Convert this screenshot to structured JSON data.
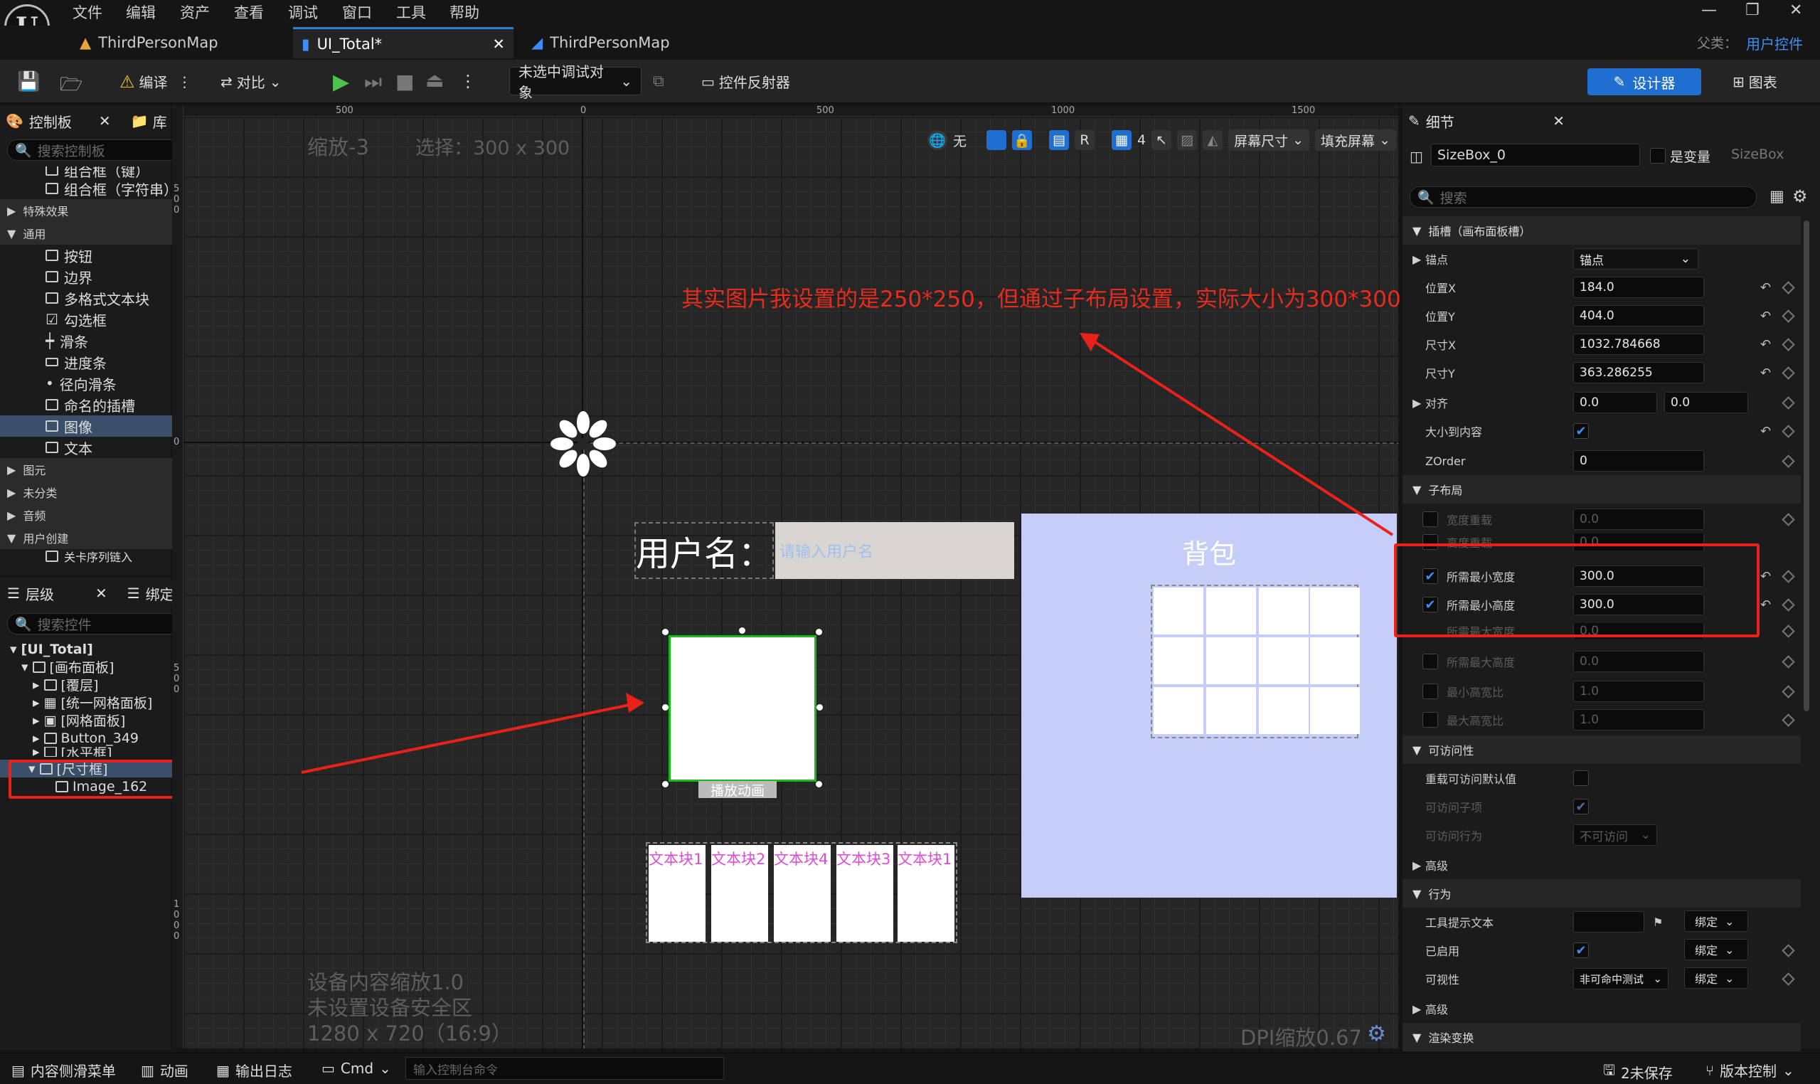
{
  "menu": [
    "文件",
    "编辑",
    "资产",
    "查看",
    "调试",
    "窗口",
    "工具",
    "帮助"
  ],
  "tabs": [
    "ThirdPersonMap",
    "UI_Total*",
    "ThirdPersonMap"
  ],
  "parent_label": "父类：",
  "parent_value": "用户控件",
  "toolbar": {
    "compile": "编译",
    "diff": "对比",
    "debug_target": "未选中调试对象",
    "widget_reflector": "控件反射器",
    "designer": "设计器",
    "graph": "图表"
  },
  "palette": {
    "tab1": "控制板",
    "tab2": "库",
    "search_placeholder": "搜索控制板",
    "partial_items": [
      "组合框（键）",
      "组合框（字符串）"
    ],
    "cat_effects": "特殊效果",
    "cat_common": "通用",
    "common_items": [
      "按钮",
      "边界",
      "多格式文本块",
      "勾选框",
      "滑条",
      "进度条",
      "径向滑条",
      "命名的插槽",
      "图像",
      "文本"
    ],
    "cat_primitive": "图元",
    "cat_uncategorized": "未分类",
    "cat_audio": "音频",
    "cat_user": "用户创建",
    "partial_user_item": "关卡序列链入"
  },
  "hierarchy": {
    "tab1": "层级",
    "tab2": "绑定控件",
    "search_placeholder": "搜索控件",
    "rows": [
      "[UI_Total]",
      "[画布面板]",
      "[覆层]",
      "[统一网格面板]",
      "[网格面板]",
      "Button_349",
      "[水平框]",
      "[尺寸框]",
      "Image_162"
    ]
  },
  "canvas": {
    "zoom": "缩放-3",
    "selection": "选择：300 x 300",
    "none_label": "无",
    "grid_num": "4",
    "r_label": "R",
    "screen_size": "屏幕尺寸",
    "fill_screen": "填充屏幕",
    "device_scale": "设备内容缩放1.0",
    "safe_zone": "未设置设备安全区",
    "resolution": "1280 x 720（16:9）",
    "dpi": "DPI缩放0.67",
    "ruler_top": [
      "500",
      "0",
      "500",
      "1000",
      "1500"
    ],
    "ruler_left": [
      "5 0 0",
      "0",
      "5 0 0",
      "1 0 0 0"
    ],
    "username_label": "用户名：",
    "username_placeholder": "请输入用户名",
    "bag_title": "背包",
    "play_anim": "播放动画",
    "text_blocks": [
      "文本块1",
      "文本块2",
      "文本块4",
      "文本块3",
      "文本块1"
    ]
  },
  "annotation": "其实图片我设置的是250*250，但通过子布局设置，实际大小为300*300",
  "details": {
    "tab": "细节",
    "widget_name": "SizeBox_0",
    "is_variable": "是变量",
    "widget_type": "SizeBox",
    "search_placeholder": "搜索",
    "slot_section": "插槽（画布面板槽）",
    "anchor_label": "锚点",
    "anchor_value": "锚点",
    "pos_x_label": "位置X",
    "pos_x": "184.0",
    "pos_y_label": "位置Y",
    "pos_y": "404.0",
    "size_x_label": "尺寸X",
    "size_x": "1032.784668",
    "size_y_label": "尺寸Y",
    "size_y": "363.286255",
    "align_label": "对齐",
    "align_x": "0.0",
    "align_y": "0.0",
    "size_to_content": "大小到内容",
    "zorder_label": "ZOrder",
    "zorder": "0",
    "child_layout": "子布局",
    "width_override": "宽度重载",
    "width_override_val": "0.0",
    "height_override": "高度重载",
    "height_override_val": "0.0",
    "min_width": "所需最小宽度",
    "min_width_val": "300.0",
    "min_height": "所需最小高度",
    "min_height_val": "300.0",
    "max_width": "所需最大宽度",
    "max_width_val": "0.0",
    "max_height": "所需最大高度",
    "max_height_val": "0.0",
    "min_aspect": "最小高宽比",
    "min_aspect_val": "1.0",
    "max_aspect": "最大高宽比",
    "max_aspect_val": "1.0",
    "accessibility": "可访问性",
    "override_access": "重载可访问默认值",
    "access_children": "可访问子项",
    "access_behavior": "可访问行为",
    "access_behavior_val": "不可访问",
    "advanced": "高级",
    "behavior": "行为",
    "tooltip": "工具提示文本",
    "enabled": "已启用",
    "visibility": "可视性",
    "visibility_val": "非可命中测试",
    "bind": "绑定",
    "render_transform": "渲染变换"
  },
  "statusbar": {
    "content_drawer": "内容侧滑菜单",
    "animation": "动画",
    "output_log": "输出日志",
    "cmd": "Cmd",
    "console_placeholder": "输入控制台命令",
    "unsaved": "2未保存",
    "source_control": "版本控制"
  },
  "colors": {
    "accent": "#1f6fd1",
    "annotation": "#e8221a",
    "bag_bg": "#c5cdf8",
    "selection": "#18b818"
  }
}
